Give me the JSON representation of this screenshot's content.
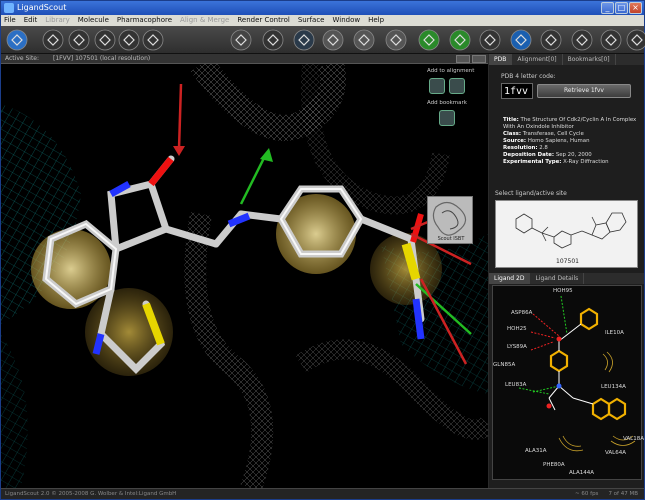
{
  "window": {
    "title": "LigandScout"
  },
  "menu": [
    {
      "label": "File",
      "disabled": false
    },
    {
      "label": "Edit",
      "disabled": false
    },
    {
      "label": "Library",
      "disabled": true
    },
    {
      "label": "Molecule",
      "disabled": false
    },
    {
      "label": "Pharmacophore",
      "disabled": false
    },
    {
      "label": "Align & Merge",
      "disabled": true
    },
    {
      "label": "Render Control",
      "disabled": false
    },
    {
      "label": "Surface",
      "disabled": false
    },
    {
      "label": "Window",
      "disabled": false
    },
    {
      "label": "Help",
      "disabled": false
    }
  ],
  "toolbar_icons": [
    "undo-icon",
    "molecule-tool-icon",
    "bond-tool-icon",
    "chain-tool-icon",
    "network-tool-icon",
    "align-tool-icon",
    "cancel-icon",
    "hydrogen-icon",
    "center-icon",
    "rotate-icon",
    "cycle-icon",
    "refresh-icon",
    "atom-green-icon",
    "feature-star-icon",
    "network-blue-icon",
    "hbond-view-icon",
    "molecule-view-icon",
    "pharmacophore-icon",
    "frame-icon",
    "export-icon"
  ],
  "viewport": {
    "active_site_label": "Active Site:",
    "active_site_value": "[1FVV] 107501 (local resolution)"
  },
  "floating": {
    "add_alignment": "Add to alignment",
    "add_bookmark": "Add bookmark",
    "thumb_label": "Scout ISBT"
  },
  "right_tabs": [
    {
      "label": "PDB",
      "selected": true
    },
    {
      "label": "Alignment[0]",
      "selected": false
    },
    {
      "label": "Bookmarks[0]",
      "selected": false
    }
  ],
  "pdb": {
    "label": "PDB 4 letter code:",
    "code": "1fvv",
    "retrieve": "Retrieve 1fvv"
  },
  "info": [
    {
      "k": "Title:",
      "v": "The Structure Of Cdk2/Cyclin A In Complex With An Oxindole Inhibitor"
    },
    {
      "k": "Class:",
      "v": "Transferase, Cell Cycle"
    },
    {
      "k": "Source:",
      "v": "Homo Sapiens, Human"
    },
    {
      "k": "Resolution:",
      "v": "2.8"
    },
    {
      "k": "Deposition Date:",
      "v": "Sep 20, 2000"
    },
    {
      "k": "Experimental Type:",
      "v": "X-Ray Diffraction"
    }
  ],
  "ligand_site": {
    "label": "Select ligand/active site",
    "id": "107501"
  },
  "bottom_tabs": [
    {
      "label": "Ligand 2D",
      "selected": true
    },
    {
      "label": "Ligand Details",
      "selected": false
    }
  ],
  "residues": [
    "HOH95",
    "ASP86A",
    "HOH25",
    "LYS89A",
    "GLN85A",
    "LEU83A",
    "ILE10A",
    "LEU134A",
    "VAL18A",
    "ALA31A",
    "VAL64A",
    "PHE80A",
    "ALA144A"
  ],
  "status": {
    "left": "LigandScout 2.0 © 2005-2008 G. Wolber & Intel:Ligand GmbH",
    "fps": "~ 60 fps",
    "memory": "7 of 47 MB"
  },
  "colors": {
    "ring_glow": "#e8d38a",
    "hbond_donor": "#2bb52b",
    "hbond_acceptor": "#d22",
    "mesh": "#1aa"
  }
}
